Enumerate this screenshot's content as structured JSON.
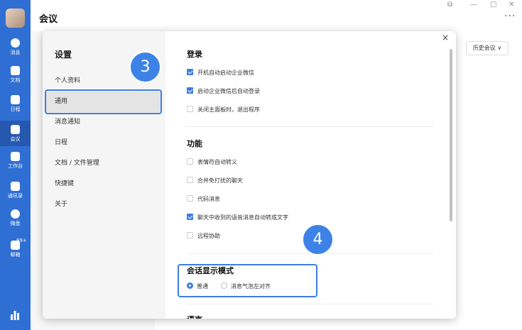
{
  "app": {
    "title": "会议"
  },
  "sidebar": {
    "items": [
      {
        "label": "消息"
      },
      {
        "label": "文档"
      },
      {
        "label": "日程"
      },
      {
        "label": "会议"
      },
      {
        "label": "工作台"
      },
      {
        "label": "通讯录"
      },
      {
        "label": "微盘"
      },
      {
        "label": "邮箱",
        "badge": "99+"
      }
    ]
  },
  "header": {
    "more": "···",
    "history_label": "历史会议 ∨"
  },
  "dialog": {
    "title": "设置",
    "close": "×",
    "nav": [
      {
        "label": "个人资料"
      },
      {
        "label": "通用"
      },
      {
        "label": "消息通知"
      },
      {
        "label": "日程"
      },
      {
        "label": "文档 / 文件管理"
      },
      {
        "label": "快捷键"
      },
      {
        "label": "关于"
      }
    ],
    "login": {
      "title": "登录",
      "options": [
        {
          "label": "开机自动启动企业微信",
          "checked": true
        },
        {
          "label": "启动企业微信后自动登录",
          "checked": true
        },
        {
          "label": "关闭主面板时，退出程序",
          "checked": false
        }
      ]
    },
    "features": {
      "title": "功能",
      "options": [
        {
          "label": "表情符自动转义",
          "checked": false
        },
        {
          "label": "合并免打扰的聊天",
          "checked": false
        },
        {
          "label": "代码消息",
          "checked": false
        },
        {
          "label": "聊天中收到的语音消息自动转成文字",
          "checked": true
        },
        {
          "label": "远程协助",
          "checked": false
        }
      ]
    },
    "display_mode": {
      "title": "会话显示模式",
      "options": [
        {
          "label": "普通",
          "selected": true
        },
        {
          "label": "消息气泡左对齐",
          "selected": false
        }
      ]
    },
    "next_section_partial": "语言"
  },
  "annotations": {
    "step3": "3",
    "step4": "4"
  },
  "colors": {
    "sidebar": "#2f6fd4",
    "accent": "#3d7de0",
    "step_badge": "#3d82e6"
  }
}
